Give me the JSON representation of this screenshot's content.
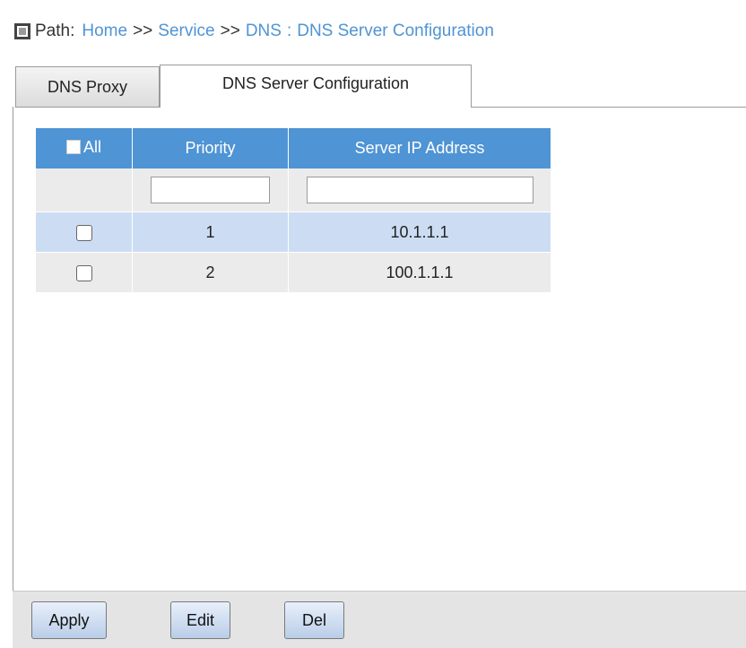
{
  "path": {
    "label": "Path:",
    "crumbs": [
      "Home",
      "Service",
      "DNS",
      "DNS Server Configuration"
    ],
    "separator": ">>",
    "colon": ":"
  },
  "tabs": [
    {
      "label": "DNS Proxy",
      "active": false
    },
    {
      "label": "DNS Server Configuration",
      "active": true
    }
  ],
  "table": {
    "headers": {
      "all": "All",
      "priority": "Priority",
      "server_ip": "Server IP Address"
    },
    "filter": {
      "priority": "",
      "server_ip": ""
    },
    "rows": [
      {
        "checked": false,
        "priority": "1",
        "server_ip": "10.1.1.1",
        "highlighted": true
      },
      {
        "checked": false,
        "priority": "2",
        "server_ip": "100.1.1.1",
        "highlighted": false
      }
    ]
  },
  "buttons": {
    "apply": "Apply",
    "edit": "Edit",
    "del": "Del"
  },
  "colors": {
    "header_blue": "#4f94d4",
    "link_blue": "#4f94d4",
    "row_highlight": "#ccddf3",
    "row_plain": "#ebebeb"
  }
}
